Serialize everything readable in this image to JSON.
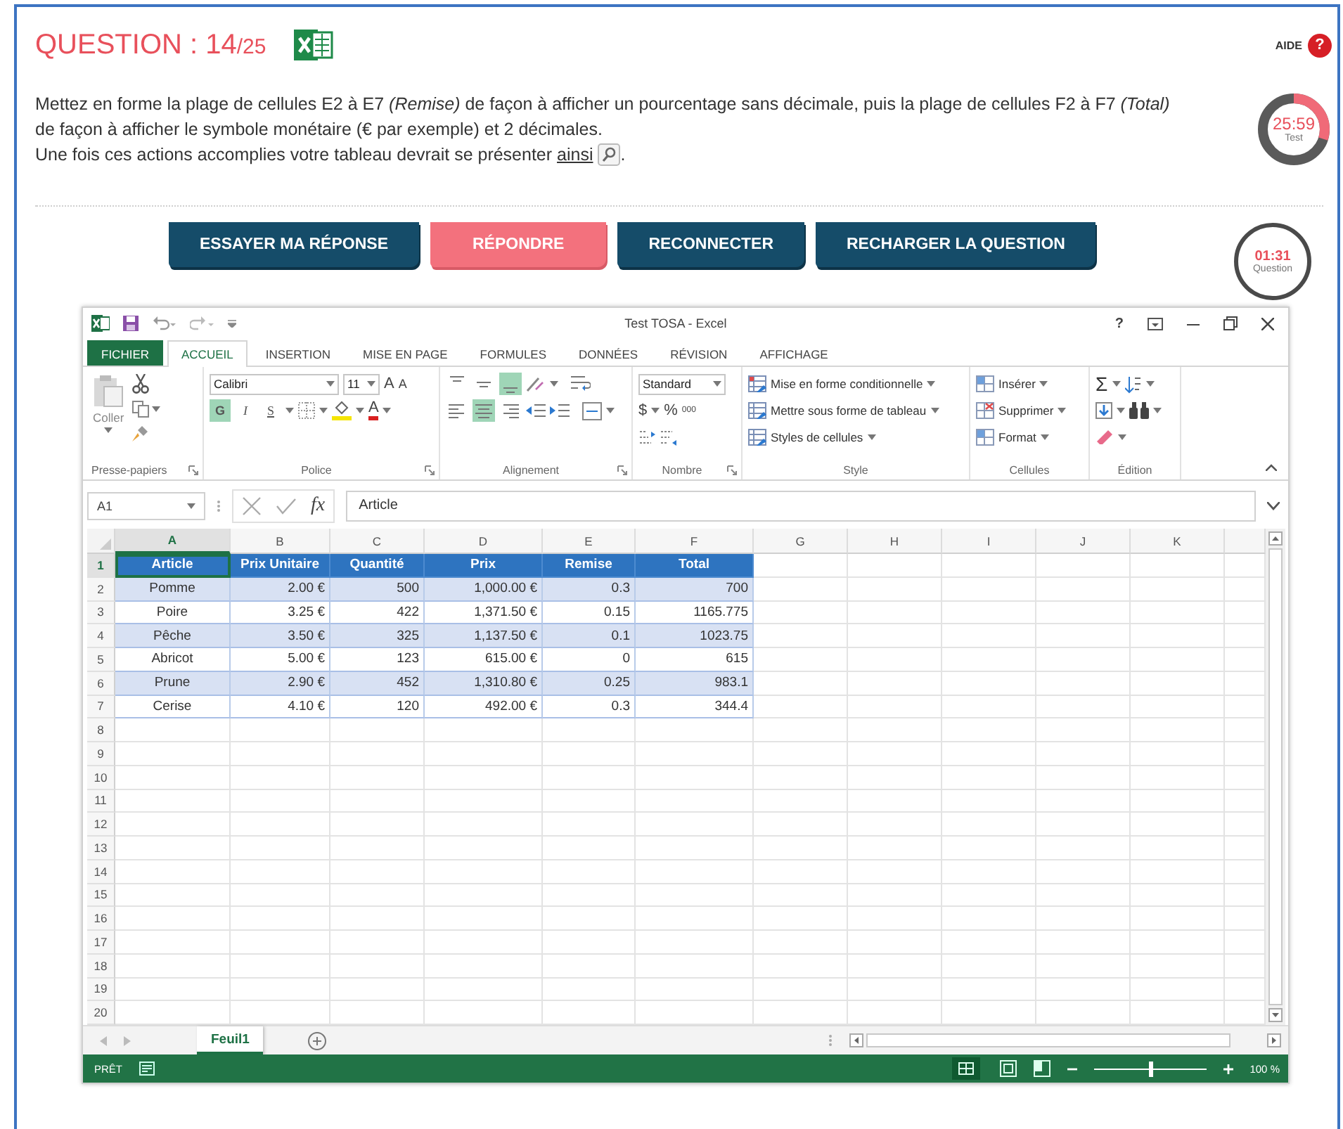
{
  "header": {
    "title": "QUESTION : 14",
    "total": "/25"
  },
  "help": {
    "label": "AIDE",
    "icon": "?"
  },
  "instructions": {
    "text": "Mettez en forme la plage de cellules E2 à E7 *(Remise)* de façon à afficher un pourcentage sans décimale, puis la plage de cellules F2 à F7 *(Total)* de façon à afficher le symbole monétaire (€ par exemple) et 2 décimales.",
    "preview_text": "Une fois ces actions accomplies votre tableau devrait se présenter",
    "preview_link": "ainsi",
    "preview_end": "."
  },
  "test_timer": {
    "time": "25:59",
    "label": "Test"
  },
  "buttons": [
    {
      "label": "ESSAYER MA RÉPONSE",
      "kind": "default"
    },
    {
      "label": "RÉPONDRE",
      "kind": "primary"
    },
    {
      "label": "RECONNECTER",
      "kind": "default"
    },
    {
      "label": "RECHARGER LA QUESTION",
      "kind": "default"
    }
  ],
  "question_timer": {
    "time": "01:31",
    "label": "Question"
  },
  "excel": {
    "title": "Test TOSA - Excel",
    "help": "?",
    "tabs": [
      {
        "label": "FICHIER",
        "kind": "file",
        "selected": false
      },
      {
        "label": "ACCUEIL",
        "kind": "tab",
        "selected": true
      },
      {
        "label": "INSERTION",
        "kind": "tab",
        "selected": false
      },
      {
        "label": "MISE EN PAGE",
        "kind": "tab",
        "selected": false
      },
      {
        "label": "FORMULES",
        "kind": "tab",
        "selected": false
      },
      {
        "label": "DONNÉES",
        "kind": "tab",
        "selected": false
      },
      {
        "label": "RÉVISION",
        "kind": "tab",
        "selected": false
      },
      {
        "label": "AFFICHAGE",
        "kind": "tab",
        "selected": false
      }
    ],
    "ribbon": {
      "clipboard": {
        "paste": "Coller",
        "label": "Presse-papiers"
      },
      "font": {
        "name": "Calibri",
        "size": "11",
        "grow": "A",
        "shrink": "A",
        "styles": [
          {
            "label": "G",
            "kind": "bold",
            "selected": true
          },
          {
            "label": "I",
            "kind": "italic",
            "selected": false
          },
          {
            "label": "S",
            "kind": "underline",
            "selected": false
          }
        ],
        "font_color": "A",
        "label": "Police"
      },
      "alignment": {
        "vertical": [
          {
            "kind": "top",
            "selected": false
          },
          {
            "kind": "middle",
            "selected": false
          },
          {
            "kind": "bottom",
            "selected": true
          }
        ],
        "horizontal": [
          {
            "kind": "left",
            "selected": false
          },
          {
            "kind": "center",
            "selected": true
          },
          {
            "kind": "right",
            "selected": false
          }
        ],
        "label": "Alignement"
      },
      "number": {
        "format": "Standard",
        "currency": "$",
        "percent": "%",
        "thousands": "000",
        "label": "Nombre"
      },
      "style": {
        "items": [
          "Mise en forme conditionnelle",
          "Mettre sous forme de tableau",
          "Styles de cellules"
        ],
        "label": "Style"
      },
      "cells": {
        "items": [
          "Insérer",
          "Supprimer",
          "Format"
        ],
        "label": "Cellules"
      },
      "editing": {
        "sum": "Σ",
        "label": "Édition"
      }
    },
    "name_box": "A1",
    "formula_icon": "fx",
    "formula": "Article",
    "sheet": {
      "columns": [
        {
          "label": "A",
          "selected": true
        },
        {
          "label": "B",
          "selected": false
        },
        {
          "label": "C",
          "selected": false
        },
        {
          "label": "D",
          "selected": false
        },
        {
          "label": "E",
          "selected": false
        },
        {
          "label": "F",
          "selected": false
        },
        {
          "label": "G",
          "selected": false
        },
        {
          "label": "H",
          "selected": false
        },
        {
          "label": "I",
          "selected": false
        },
        {
          "label": "J",
          "selected": false
        },
        {
          "label": "K",
          "selected": false
        }
      ],
      "rows": [
        {
          "number": "1",
          "selected": true,
          "kind": "header",
          "cells": [
            "Article",
            "Prix Unitaire",
            "Quantité",
            "Prix",
            "Remise",
            "Total"
          ]
        },
        {
          "number": "2",
          "selected": false,
          "kind": "data",
          "cells": [
            "Pomme",
            "2.00 €",
            "500",
            "1,000.00 €",
            "0.3",
            "700"
          ]
        },
        {
          "number": "3",
          "selected": false,
          "kind": "data",
          "cells": [
            "Poire",
            "3.25 €",
            "422",
            "1,371.50 €",
            "0.15",
            "1165.775"
          ]
        },
        {
          "number": "4",
          "selected": false,
          "kind": "data",
          "cells": [
            "Pêche",
            "3.50 €",
            "325",
            "1,137.50 €",
            "0.1",
            "1023.75"
          ]
        },
        {
          "number": "5",
          "selected": false,
          "kind": "data",
          "cells": [
            "Abricot",
            "5.00 €",
            "123",
            "615.00 €",
            "0",
            "615"
          ]
        },
        {
          "number": "6",
          "selected": false,
          "kind": "data",
          "cells": [
            "Prune",
            "2.90 €",
            "452",
            "1,310.80 €",
            "0.25",
            "983.1"
          ]
        },
        {
          "number": "7",
          "selected": false,
          "kind": "data",
          "cells": [
            "Cerise",
            "4.10 €",
            "120",
            "492.00 €",
            "0.3",
            "344.4"
          ]
        },
        {
          "number": "8",
          "selected": false
        },
        {
          "number": "9",
          "selected": false
        },
        {
          "number": "10",
          "selected": false
        },
        {
          "number": "11",
          "selected": false
        },
        {
          "number": "12",
          "selected": false
        },
        {
          "number": "13",
          "selected": false
        },
        {
          "number": "14",
          "selected": false
        },
        {
          "number": "15",
          "selected": false
        },
        {
          "number": "16",
          "selected": false
        },
        {
          "number": "17",
          "selected": false
        },
        {
          "number": "18",
          "selected": false
        },
        {
          "number": "19",
          "selected": false
        },
        {
          "number": "20",
          "selected": false
        }
      ]
    },
    "sheet_tabs": [
      {
        "label": "Feuil1",
        "selected": true
      }
    ],
    "status": {
      "label": "PRÊT",
      "zoom_slider": {
        "level": 0.5
      },
      "zoom": "100 %"
    }
  }
}
